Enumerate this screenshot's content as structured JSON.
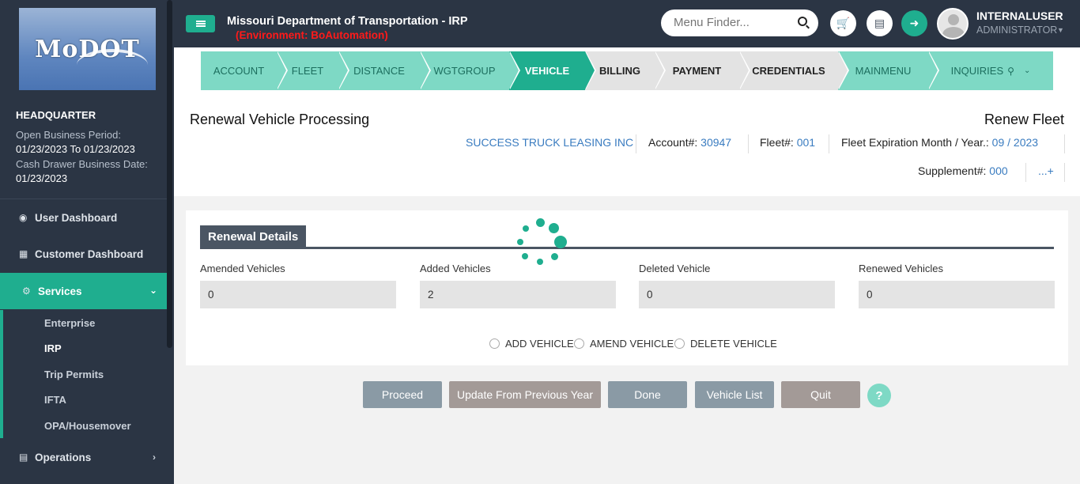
{
  "app": {
    "title": "Missouri Department of Transportation - IRP",
    "environment": "(Environment: BoAutomation)",
    "logo_text": "MoDOT"
  },
  "header": {
    "search_placeholder": "Menu Finder...",
    "user_name": "INTERNALUSER",
    "user_role": "ADMINISTRATOR"
  },
  "sidebar": {
    "org": "HEADQUARTER",
    "open_business_period_label": "Open Business Period:",
    "open_business_period_value": "01/23/2023 To 01/23/2023",
    "cash_drawer_label": "Cash Drawer Business Date:",
    "cash_drawer_value": "01/23/2023",
    "items": [
      {
        "label": "User Dashboard",
        "icon": "dashboard-icon"
      },
      {
        "label": "Customer Dashboard",
        "icon": "grid-icon"
      },
      {
        "label": "Services",
        "icon": "gears-icon"
      },
      {
        "label": "Operations",
        "icon": "operations-icon"
      }
    ],
    "sub_items": [
      "Enterprise",
      "IRP",
      "Trip Permits",
      "IFTA",
      "OPA/Housemover"
    ]
  },
  "steps": [
    {
      "label": "ACCOUNT",
      "state": "done"
    },
    {
      "label": "FLEET",
      "state": "done"
    },
    {
      "label": "DISTANCE",
      "state": "done"
    },
    {
      "label": "WGTGROUP",
      "state": "done"
    },
    {
      "label": "VEHICLE",
      "state": "active"
    },
    {
      "label": "BILLING",
      "state": "pending"
    },
    {
      "label": "PAYMENT",
      "state": "pending"
    },
    {
      "label": "CREDENTIALS",
      "state": "pending"
    },
    {
      "label": "MAINMENU",
      "state": "done"
    },
    {
      "label": "INQUIRIES",
      "state": "done"
    }
  ],
  "page": {
    "title": "Renewal Vehicle Processing",
    "right_title": "Renew Fleet",
    "company": "SUCCESS TRUCK LEASING INC",
    "account_label": "Account#:",
    "account_value": "30947",
    "fleet_label": "Fleet#:",
    "fleet_value": "001",
    "expiration_label": "Fleet Expiration Month / Year.:",
    "expiration_value": "09 / 2023",
    "supplement_label": "Supplement#:",
    "supplement_value": "000",
    "more_link": "...+"
  },
  "renewal_details": {
    "heading": "Renewal Details",
    "fields": [
      {
        "label": "Amended Vehicles",
        "value": "0"
      },
      {
        "label": "Added Vehicles",
        "value": "2"
      },
      {
        "label": "Deleted Vehicle",
        "value": "0"
      },
      {
        "label": "Renewed Vehicles",
        "value": "0"
      }
    ],
    "options": [
      "ADD VEHICLE",
      "AMEND VEHICLE",
      "DELETE VEHICLE"
    ]
  },
  "buttons": [
    "Proceed",
    "Update From Previous Year",
    "Done",
    "Vehicle List",
    "Quit"
  ],
  "help_label": "?",
  "watermark": "omation",
  "colors": {
    "sidebar_bg": "#2b3544",
    "accent": "#1fae8f",
    "step_done": "#7ed9c5",
    "env_red": "#ff1a1a",
    "link_blue": "#3a7cc0"
  }
}
